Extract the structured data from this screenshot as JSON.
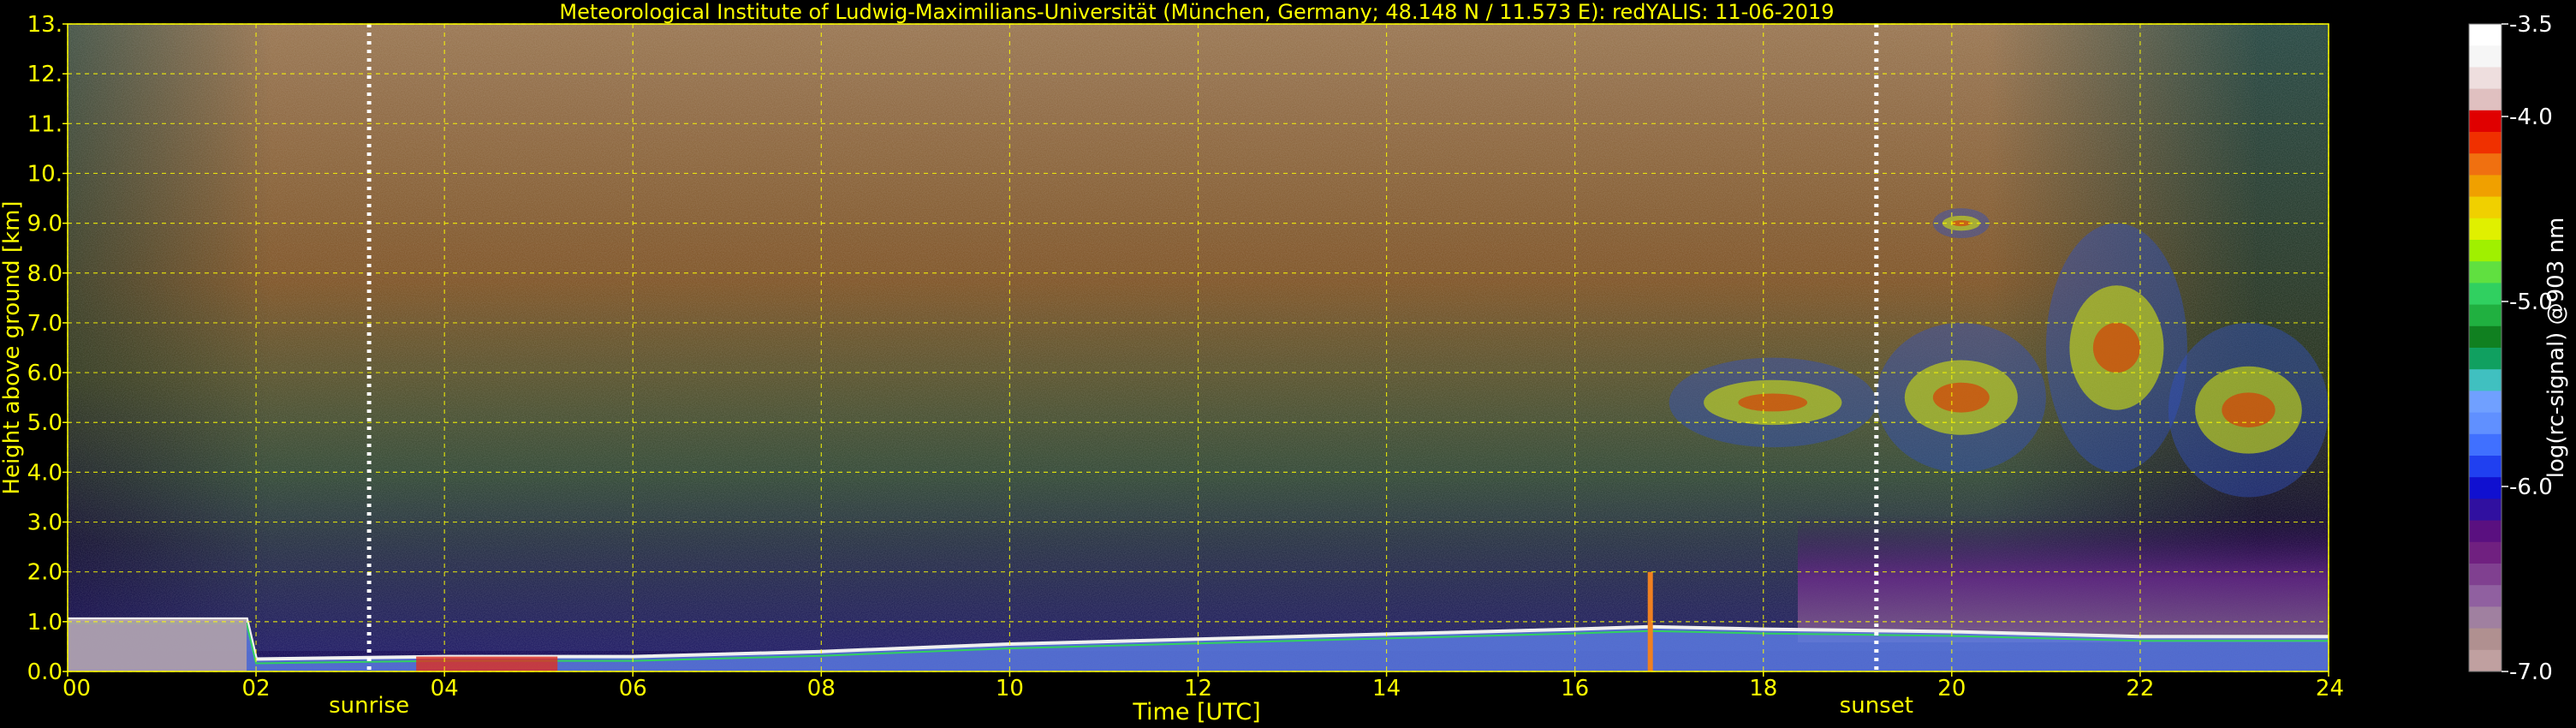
{
  "chart_data": {
    "type": "heatmap",
    "title": "Meteorological Institute of Ludwig-Maximilians-Universität (München, Germany; 48.148 N / 11.573 E):    redYALIS: 11-06-2019",
    "xlabel": "Time [UTC]",
    "ylabel": "Height above ground [km]",
    "xlim": [
      0,
      24
    ],
    "ylim": [
      0,
      13
    ],
    "x_ticks": [
      "00",
      "02",
      "04",
      "06",
      "08",
      "10",
      "12",
      "14",
      "16",
      "18",
      "20",
      "22",
      "24"
    ],
    "y_ticks": [
      "0.0",
      "1.0",
      "2.0",
      "3.0",
      "4.0",
      "5.0",
      "6.0",
      "7.0",
      "8.0",
      "9.0",
      "10.",
      "11.",
      "12.",
      "13."
    ],
    "grid": true,
    "annotations": [
      {
        "label": "sunrise",
        "x": 3.2
      },
      {
        "label": "sunset",
        "x": 19.2
      }
    ],
    "colorbar": {
      "label": "log(rc-signal) @903 nm",
      "range": [
        -7.0,
        -3.5
      ],
      "ticks": [
        "-3.5",
        "-4.0",
        "-5.0",
        "-6.0",
        "-7.0"
      ],
      "tick_values": [
        -3.5,
        -4.0,
        -5.0,
        -6.0,
        -7.0
      ],
      "colors": [
        "#ffffff",
        "#f6f6f6",
        "#eedede",
        "#e0c0c0",
        "#e00000",
        "#f03000",
        "#f07010",
        "#f0a000",
        "#f0d000",
        "#e0f000",
        "#a0f000",
        "#60e040",
        "#30d060",
        "#20b040",
        "#108020",
        "#10a060",
        "#40c0c0",
        "#70a0ff",
        "#6090ff",
        "#4070ff",
        "#2040f0",
        "#1010d0",
        "#3010a0",
        "#5a1080",
        "#702080",
        "#804090",
        "#9060a0",
        "#a080a0",
        "#b09090",
        "#c0a0a0"
      ]
    },
    "boundary_layer_top_km": [
      {
        "x": 0,
        "y": 1.05
      },
      {
        "x": 1.9,
        "y": 1.05
      },
      {
        "x": 2.0,
        "y": 0.25
      },
      {
        "x": 4,
        "y": 0.3
      },
      {
        "x": 6,
        "y": 0.3
      },
      {
        "x": 8,
        "y": 0.4
      },
      {
        "x": 10,
        "y": 0.55
      },
      {
        "x": 12,
        "y": 0.65
      },
      {
        "x": 14,
        "y": 0.75
      },
      {
        "x": 16,
        "y": 0.85
      },
      {
        "x": 16.8,
        "y": 0.9
      },
      {
        "x": 18,
        "y": 0.85
      },
      {
        "x": 20,
        "y": 0.8
      },
      {
        "x": 22,
        "y": 0.7
      },
      {
        "x": 24,
        "y": 0.7
      }
    ],
    "cloud_layers": [
      {
        "t0": 17.0,
        "t1": 19.2,
        "h0": 4.5,
        "h1": 6.3
      },
      {
        "t0": 19.2,
        "t1": 21.0,
        "h0": 4.0,
        "h1": 7.0
      },
      {
        "t0": 19.8,
        "t1": 20.4,
        "h0": 8.7,
        "h1": 9.3
      },
      {
        "t0": 21.0,
        "t1": 22.5,
        "h0": 4.0,
        "h1": 9.0
      },
      {
        "t0": 22.3,
        "t1": 24.0,
        "h0": 3.5,
        "h1": 7.0
      }
    ]
  }
}
